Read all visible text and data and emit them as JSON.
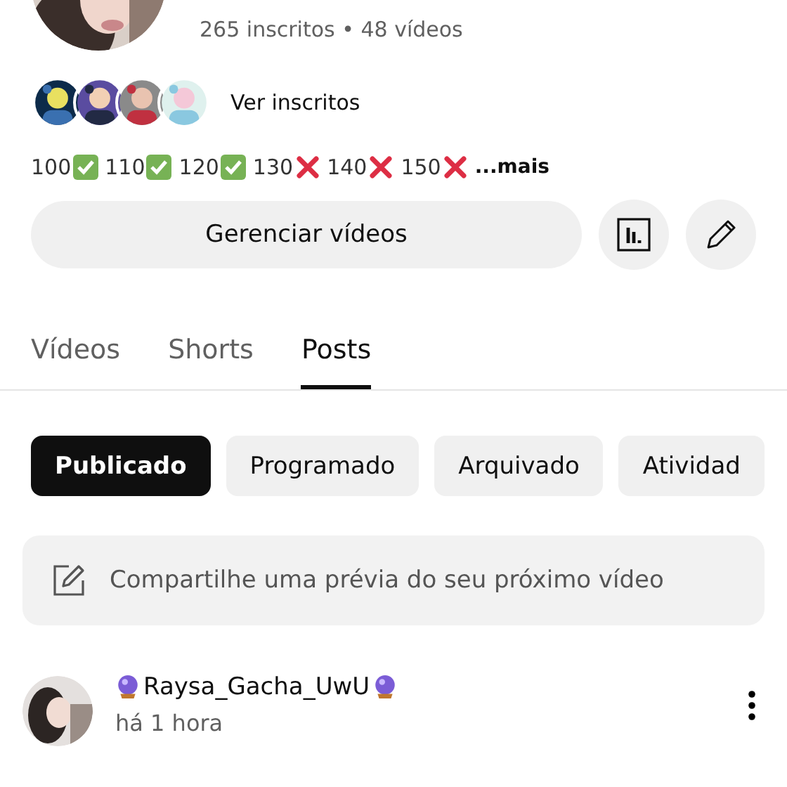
{
  "channel": {
    "stats": "265 inscritos • 48 vídeos",
    "subscribers_link": "Ver inscritos"
  },
  "milestones": [
    {
      "number": "100",
      "kind": "check"
    },
    {
      "number": "110",
      "kind": "check"
    },
    {
      "number": "120",
      "kind": "check"
    },
    {
      "number": "130",
      "kind": "cross"
    },
    {
      "number": "140",
      "kind": "cross"
    },
    {
      "number": "150",
      "kind": "cross"
    }
  ],
  "milestones_more": "...mais",
  "manage_button": "Gerenciar vídeos",
  "tabs": [
    {
      "label": "Vídeos",
      "selected": false
    },
    {
      "label": "Shorts",
      "selected": false
    },
    {
      "label": "Posts",
      "selected": true
    }
  ],
  "filters": [
    {
      "label": "Publicado",
      "selected": true
    },
    {
      "label": "Programado",
      "selected": false
    },
    {
      "label": "Arquivado",
      "selected": false
    },
    {
      "label": "Atividad",
      "selected": false
    }
  ],
  "composer": {
    "placeholder": "Compartilhe uma prévia do seu próximo vídeo"
  },
  "post": {
    "author": "Raysa_Gacha_UwU",
    "time": "há 1 hora"
  }
}
